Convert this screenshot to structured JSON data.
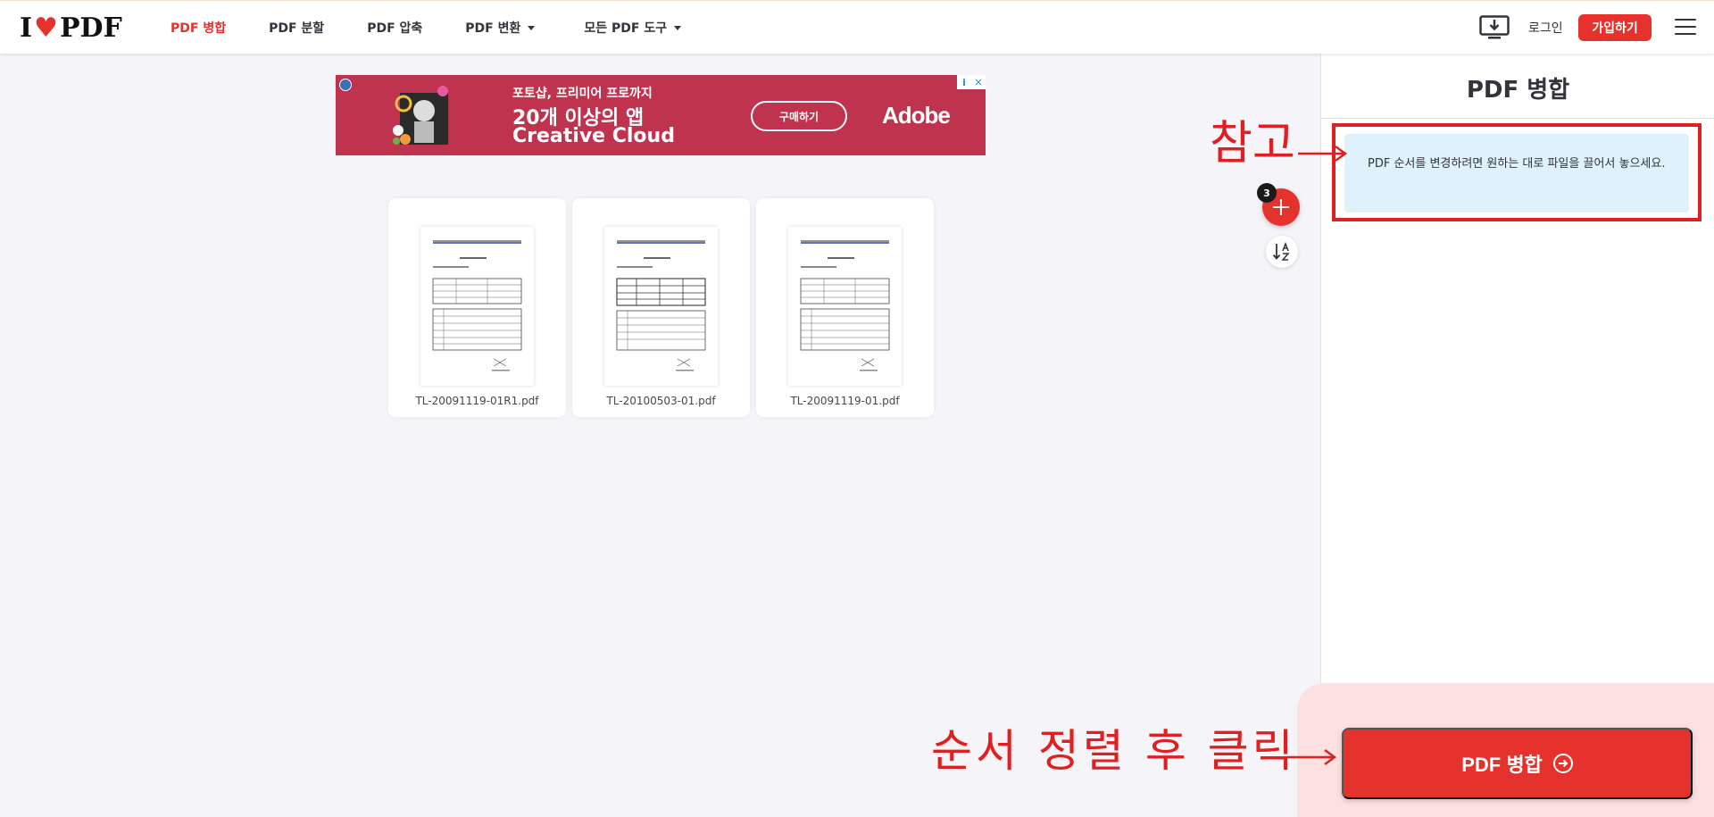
{
  "header": {
    "logo_left": "I",
    "logo_right": "PDF",
    "nav": [
      {
        "label": "PDF 병합",
        "active": true,
        "dropdown": false
      },
      {
        "label": "PDF 분할",
        "active": false,
        "dropdown": false
      },
      {
        "label": "PDF 압축",
        "active": false,
        "dropdown": false
      },
      {
        "label": "PDF 변환",
        "active": false,
        "dropdown": true
      },
      {
        "label": "모든 PDF 도구",
        "active": false,
        "dropdown": true
      }
    ],
    "login": "로그인",
    "signup": "가입하기",
    "icons": [
      "desktop-download-icon",
      "hamburger-menu-icon"
    ]
  },
  "ad": {
    "line1": "포토샵, 프리미어 프로까지",
    "line2": "20개 이상의 앱",
    "line3": "Creative Cloud",
    "cta": "구매하기",
    "brand": "Adobe"
  },
  "files": [
    {
      "name": "TL-20091119-01R1.pdf"
    },
    {
      "name": "TL-20100503-01.pdf"
    },
    {
      "name": "TL-20091119-01.pdf"
    }
  ],
  "controls": {
    "file_count": "3",
    "icons": [
      "plus-icon",
      "sort-az-icon"
    ]
  },
  "sidebar": {
    "title": "PDF 병합",
    "info": "PDF 순서를 변경하려면 원하는 대로 파일을 끌어서 놓으세요.",
    "merge_button": "PDF 병합"
  },
  "annotations": {
    "note": "참고",
    "instruction": "순서 정렬 후 클릭"
  },
  "colors": {
    "brand_red": "#e5322d",
    "annotation_red": "#e02020",
    "info_bg": "#dff1fb"
  }
}
